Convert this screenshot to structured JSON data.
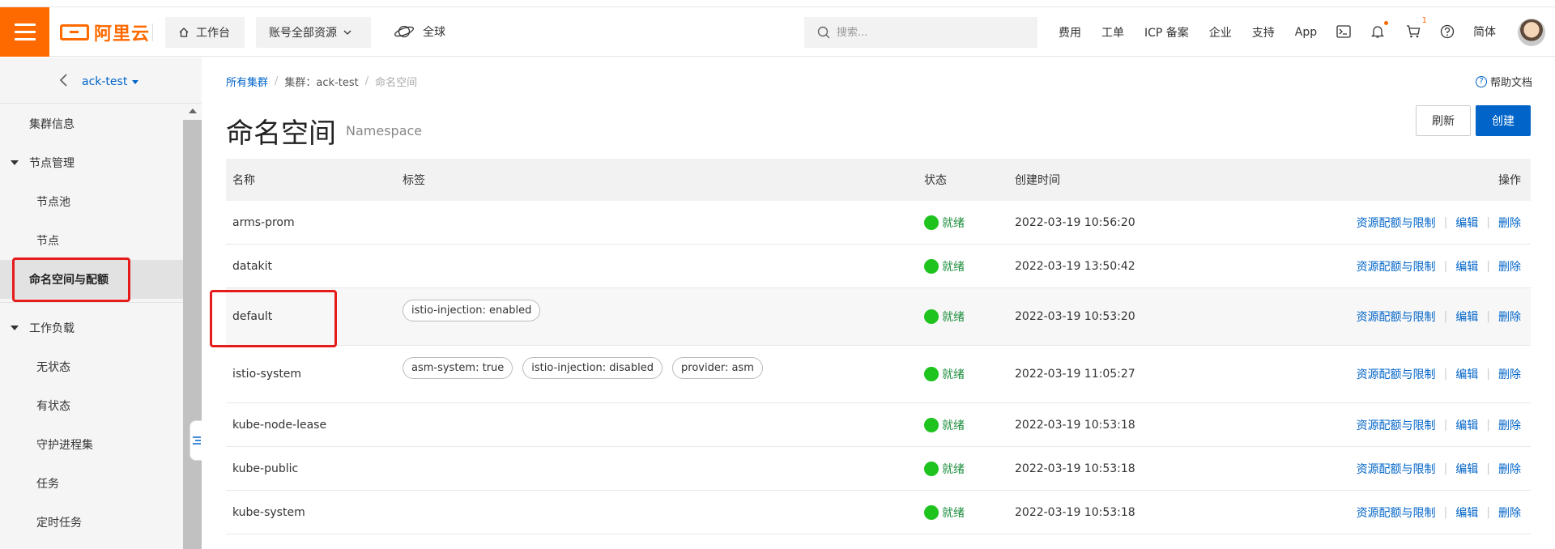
{
  "topbar": {
    "logo_text": "阿里云",
    "home_label": "工作台",
    "resources_label": "账号全部资源",
    "region_label": "全球",
    "search_placeholder": "搜索...",
    "links": [
      "费用",
      "工单",
      "ICP 备案",
      "企业",
      "支持",
      "App"
    ],
    "cart_count": "1",
    "lang_label": "简体"
  },
  "sidebar": {
    "cluster_name": "ack-test",
    "items": [
      {
        "label": "集群信息"
      },
      {
        "label": "节点管理"
      },
      {
        "label": "节点池"
      },
      {
        "label": "节点"
      },
      {
        "label": "命名空间与配额"
      },
      {
        "label": "工作负载"
      },
      {
        "label": "无状态"
      },
      {
        "label": "有状态"
      },
      {
        "label": "守护进程集"
      },
      {
        "label": "任务"
      },
      {
        "label": "定时任务"
      }
    ]
  },
  "breadcrumb": {
    "all_clusters": "所有集群",
    "cluster": "集群：ack-test",
    "current": "命名空间"
  },
  "help_label": "帮助文档",
  "page": {
    "title": "命名空间",
    "subtitle": "Namespace",
    "refresh_label": "刷新",
    "create_label": "创建"
  },
  "table": {
    "headers": {
      "name": "名称",
      "tags": "标签",
      "status": "状态",
      "created": "创建时间",
      "ops": "操作"
    },
    "rows": [
      {
        "name": "arms-prom",
        "tags": [],
        "status": "就绪",
        "created": "2022-03-19 10:56:20"
      },
      {
        "name": "datakit",
        "tags": [],
        "status": "就绪",
        "created": "2022-03-19 13:50:42"
      },
      {
        "name": "default",
        "tags": [
          "istio-injection: enabled"
        ],
        "status": "就绪",
        "created": "2022-03-19 10:53:20"
      },
      {
        "name": "istio-system",
        "tags": [
          "asm-system: true",
          "istio-injection: disabled",
          "provider: asm"
        ],
        "status": "就绪",
        "created": "2022-03-19 11:05:27"
      },
      {
        "name": "kube-node-lease",
        "tags": [],
        "status": "就绪",
        "created": "2022-03-19 10:53:18"
      },
      {
        "name": "kube-public",
        "tags": [],
        "status": "就绪",
        "created": "2022-03-19 10:53:18"
      },
      {
        "name": "kube-system",
        "tags": [],
        "status": "就绪",
        "created": "2022-03-19 10:53:18"
      }
    ],
    "op_labels": {
      "quota": "资源配额与限制",
      "edit": "编辑",
      "delete": "删除"
    }
  },
  "colors": {
    "brand": "#ff6a00",
    "link": "#0064c8",
    "status_ok": "#1ec31e",
    "highlight": "#e61b1b"
  }
}
